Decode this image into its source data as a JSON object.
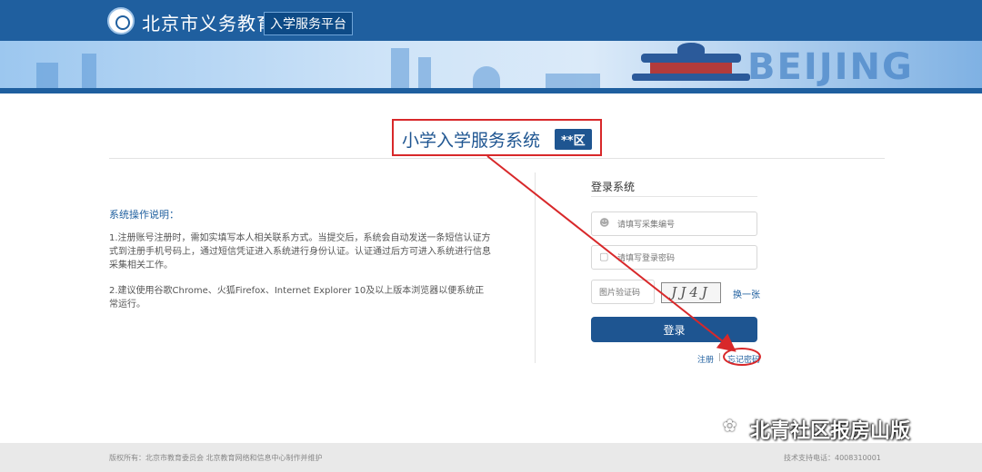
{
  "header": {
    "brand_title": "北京市义务教育",
    "brand_subtitle": "入学服务平台",
    "banner_text": "BEIJING"
  },
  "system": {
    "title": "小学入学服务系统",
    "district": "**区"
  },
  "instructions": {
    "title": "系统操作说明：",
    "item1": "1.注册账号注册时，需如实填写本人相关联系方式。当提交后，系统会自动发送一条短信认证方式到注册手机号码上，通过短信凭证进入系统进行身份认证。认证通过后方可进入系统进行信息采集相关工作。",
    "item2": "2.建议使用谷歌Chrome、火狐Firefox、Internet Explorer 10及以上版本浏览器以便系统正常运行。"
  },
  "login": {
    "title": "登录系统",
    "username_placeholder": "请填写采集编号",
    "password_placeholder": "请填写登录密码",
    "captcha_placeholder": "图片验证码",
    "captcha_text": "JJ4J",
    "refresh_label": "换一张",
    "submit_label": "登录",
    "register_label": "注册",
    "separator": "|",
    "forgot_label": "忘记密码"
  },
  "watermark": {
    "text": "北青社区报房山版"
  },
  "footer": {
    "copyright": "版权所有：北京市教育委员会 北京教育网络和信息中心制作并维护",
    "support": "技术支持电话：4008310001"
  },
  "colors": {
    "primary": "#1e5591",
    "highlight_red": "#d8282a"
  }
}
